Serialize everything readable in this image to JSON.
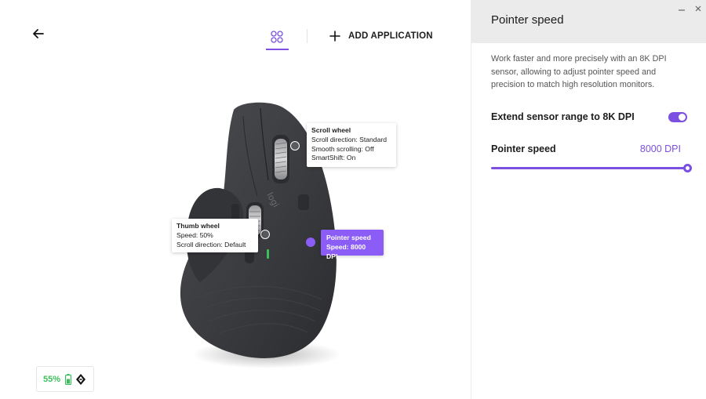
{
  "header": {
    "add_application_label": "ADD APPLICATION"
  },
  "icons": {
    "back": "back-arrow-icon",
    "apps": "apps-grid-icon",
    "add": "plus-icon",
    "battery": "battery-icon",
    "connection": "unifying-receiver-icon",
    "minimize": "minimize-icon",
    "close": "close-icon"
  },
  "callouts": {
    "scroll_wheel": {
      "title": "Scroll wheel",
      "line1": "Scroll direction: Standard",
      "line2": "Smooth scrolling: Off",
      "line3": "SmartShift: On"
    },
    "thumb_wheel": {
      "title": "Thumb wheel",
      "line1": "Speed: 50%",
      "line2": "Scroll direction: Default"
    },
    "pointer_speed": {
      "title": "Pointer speed",
      "line1": "Speed: 8000 DPI"
    }
  },
  "device": {
    "brand_text": "logi",
    "battery_percent": "55%"
  },
  "panel": {
    "title": "Pointer speed",
    "description": "Work faster and more precisely with an 8K DPI sensor, allowing to adjust pointer speed and precision to match high resolution monitors.",
    "extend_label": "Extend sensor range to 8K DPI",
    "extend_enabled": true,
    "speed_label": "Pointer speed",
    "speed_value": "8000 DPI",
    "slider_fraction": 1.0
  },
  "colors": {
    "accent": "#7b4fe0",
    "callout_accent": "#8b5cf6",
    "battery_green": "#3dbd5b",
    "panel_header": "#ebebeb"
  }
}
